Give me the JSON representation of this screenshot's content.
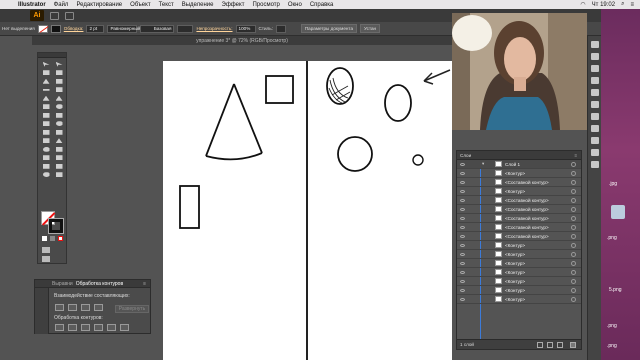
{
  "menubar": {
    "app": "Illustrator",
    "items": [
      "Файл",
      "Редактирование",
      "Объект",
      "Текст",
      "Выделение",
      "Эффект",
      "Просмотр",
      "Окно",
      "Справка"
    ],
    "clock": "Чт 19:02"
  },
  "control": {
    "selection": "Нет выделения",
    "stroke_label": "Обводка:",
    "stroke_value": "2 pt",
    "profile": "Равномерный",
    "brush": "Базовая",
    "opacity_label": "Непрозрачность:",
    "opacity_value": "100%",
    "style_label": "Стиль:",
    "doc_settings": "Параметры документа",
    "install": "Устан"
  },
  "document": {
    "tab_title": "упражнение 3* @ 72% (RGB/Просмотр)"
  },
  "pathfinder": {
    "tabs": [
      "Выравни",
      "Обработка контуров"
    ],
    "shape_modes": "Взаимодействие составляющих:",
    "expand": "Развернуть",
    "pathfinders": "Обработка контуров:"
  },
  "layers": {
    "title": "Слои",
    "layer_name": "Слой 1",
    "items": [
      "<Контур>",
      "<Составной контур>",
      "<Контур>",
      "<Составной контур>",
      "<Составной контур>",
      "<Составной контур>",
      "<Составной контур>",
      "<Составной контур>",
      "<Контур>",
      "<Контур>",
      "<Контур>",
      "<Контур>",
      "<Контур>",
      "<Контур>",
      "<Контур>"
    ],
    "footer": "1 слой"
  },
  "desktop": {
    "files": [
      ".jpg",
      ".png",
      "5.png",
      ".png",
      ".png"
    ]
  },
  "colors": {
    "ui_dark": "#535353",
    "panel": "#4a4a4a",
    "accent": "#ff9a00",
    "selection_blue": "#3c7bd9",
    "desktop": "#8a3a6f"
  }
}
